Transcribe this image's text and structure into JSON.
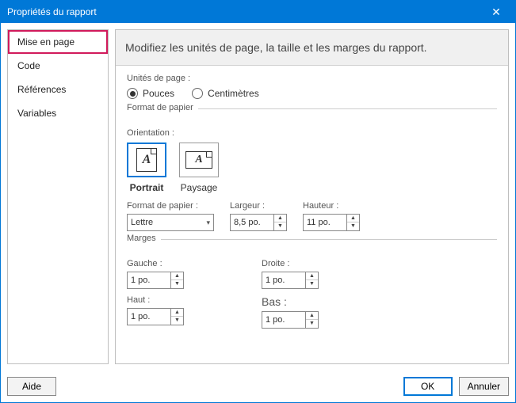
{
  "window": {
    "title": "Propriétés du rapport"
  },
  "sidebar": {
    "items": [
      {
        "label": "Mise en page"
      },
      {
        "label": "Code"
      },
      {
        "label": "Références"
      },
      {
        "label": "Variables"
      }
    ]
  },
  "header": {
    "text": "Modifiez les unités de page, la taille et les marges du rapport."
  },
  "units": {
    "label": "Unités de page :",
    "inches": "Pouces",
    "centimeters": "Centimètres"
  },
  "paper": {
    "group": "Format de papier",
    "orientation_label": "Orientation :",
    "portrait": "Portrait",
    "landscape": "Paysage",
    "size_label": "Format de papier :",
    "size_value": "Lettre",
    "width_label": "Largeur :",
    "width_value": "8,5 po.",
    "height_label": "Hauteur :",
    "height_value": "11 po."
  },
  "margins": {
    "group": "Marges",
    "left_label": "Gauche :",
    "left_value": "1 po.",
    "right_label": "Droite :",
    "right_value": "1 po.",
    "top_label": "Haut :",
    "top_value": "1 po.",
    "bottom_label": "Bas :",
    "bottom_value": "1 po."
  },
  "footer": {
    "help": "Aide",
    "ok": "OK",
    "cancel": "Annuler"
  }
}
